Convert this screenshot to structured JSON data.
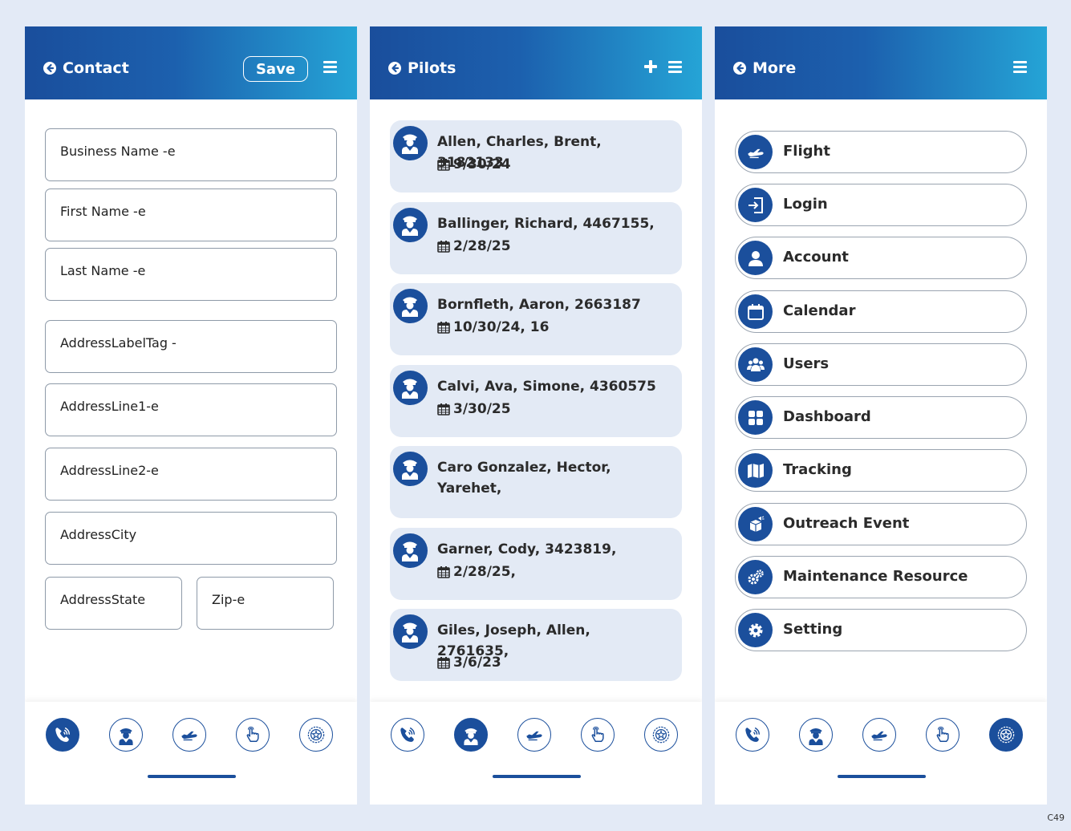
{
  "screens": {
    "contact": {
      "title": "Contact",
      "save_label": "Save",
      "fields": [
        "Business Name -e",
        "First Name -e",
        "Last Name -e",
        "AddressLabelTag -",
        "AddressLine1-e",
        "AddressLine2-e",
        "AddressCity",
        "AddressState",
        "Zip-e"
      ]
    },
    "pilots": {
      "title": "Pilots",
      "items": [
        {
          "name": "Allen, Charles, Brent, 3182133",
          "date": "9/30/24"
        },
        {
          "name": "Ballinger, Richard, 4467155,",
          "date": "2/28/25"
        },
        {
          "name": "Bornfleth, Aaron, 2663187",
          "date": "10/30/24, 16"
        },
        {
          "name": "Calvi, Ava, Simone, 4360575",
          "date": "3/30/25"
        },
        {
          "name": "Caro Gonzalez, Hector, Yarehet,",
          "date": ""
        },
        {
          "name": "Garner, Cody, 3423819,",
          "date": "2/28/25,"
        },
        {
          "name": "Giles, Joseph, Allen, 2761635,",
          "date": "3/6/23"
        }
      ]
    },
    "more": {
      "title": "More",
      "items": [
        {
          "label": "Flight",
          "icon": "plane-icon"
        },
        {
          "label": "Login",
          "icon": "login-icon"
        },
        {
          "label": "Account",
          "icon": "user-icon"
        },
        {
          "label": "Calendar",
          "icon": "calendar-icon"
        },
        {
          "label": "Users",
          "icon": "users-icon"
        },
        {
          "label": "Dashboard",
          "icon": "dashboard-icon"
        },
        {
          "label": "Tracking",
          "icon": "map-icon"
        },
        {
          "label": "Outreach Event",
          "icon": "megaphone-icon"
        },
        {
          "label": "Maintenance Resource",
          "icon": "cogs-icon"
        },
        {
          "label": "Setting",
          "icon": "gear-icon"
        }
      ]
    }
  },
  "nav_icons": [
    "phone-icon",
    "pilot-icon",
    "plane-icon",
    "tap-icon",
    "badge-icon"
  ],
  "footer_code": "C49",
  "colors": {
    "primary": "#1b4f9c",
    "header_gradient_start": "#1a4e9c",
    "header_gradient_end": "#25a4d6",
    "card_bg": "#e3eaf5",
    "page_bg": "#e3eaf6"
  }
}
